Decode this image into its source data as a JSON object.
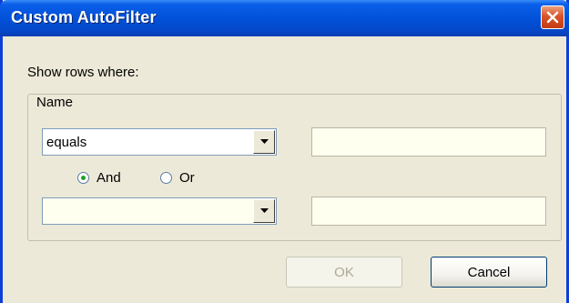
{
  "window": {
    "title": "Custom AutoFilter"
  },
  "labels": {
    "show_rows": "Show rows where:",
    "group": "Name"
  },
  "criteria1": {
    "operator": "equals",
    "value": ""
  },
  "logic": {
    "and_label": "And",
    "or_label": "Or",
    "selected": "And"
  },
  "criteria2": {
    "operator": "",
    "value": ""
  },
  "buttons": {
    "ok": "OK",
    "cancel": "Cancel",
    "ok_enabled": false
  },
  "colors": {
    "titlebar": "#0250d8",
    "dialog_bg": "#ece9d8",
    "field_bg": "#fffff0",
    "close": "#c43b14"
  }
}
